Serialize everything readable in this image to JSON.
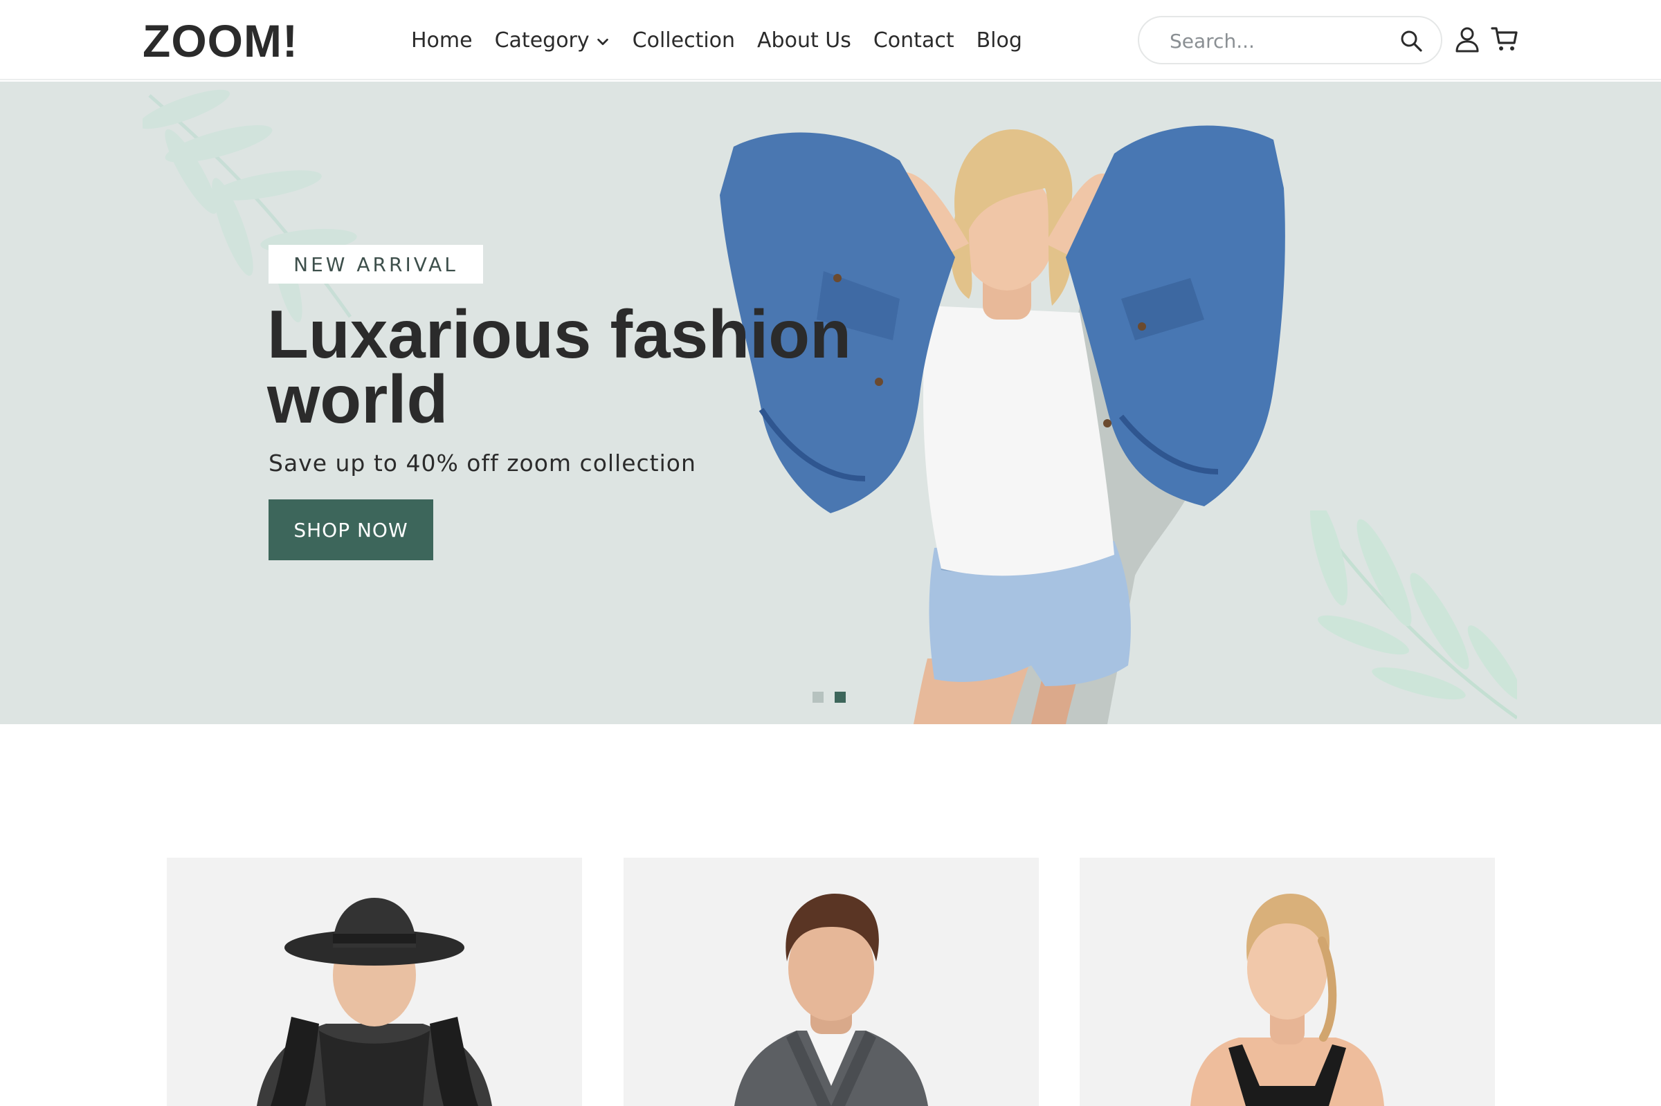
{
  "header": {
    "logo": "ZOOM!",
    "nav": [
      {
        "label": "Home"
      },
      {
        "label": "Category"
      },
      {
        "label": "Collection"
      },
      {
        "label": "About Us"
      },
      {
        "label": "Contact"
      },
      {
        "label": "Blog"
      }
    ],
    "search": {
      "placeholder": "Search..."
    },
    "icons": [
      "search-icon",
      "user-icon",
      "cart-icon",
      "chevron-down-icon"
    ]
  },
  "hero": {
    "badge": "NEW ARRIVAL",
    "title": "Luxarious fashion world",
    "subtitle": "Save up to 40% off zoom collection",
    "cta": "SHOP NOW",
    "slides_total": 2,
    "active_slide": 2
  },
  "products": [
    {
      "image": "woman-with-black-hat"
    },
    {
      "image": "man-in-grey-blazer"
    },
    {
      "image": "woman-in-black-tank-top"
    }
  ],
  "colors": {
    "hero_bg": "#dde4e2",
    "accent": "#3d665b",
    "text": "#2b2b2b",
    "card_bg": "#f2f2f2"
  }
}
